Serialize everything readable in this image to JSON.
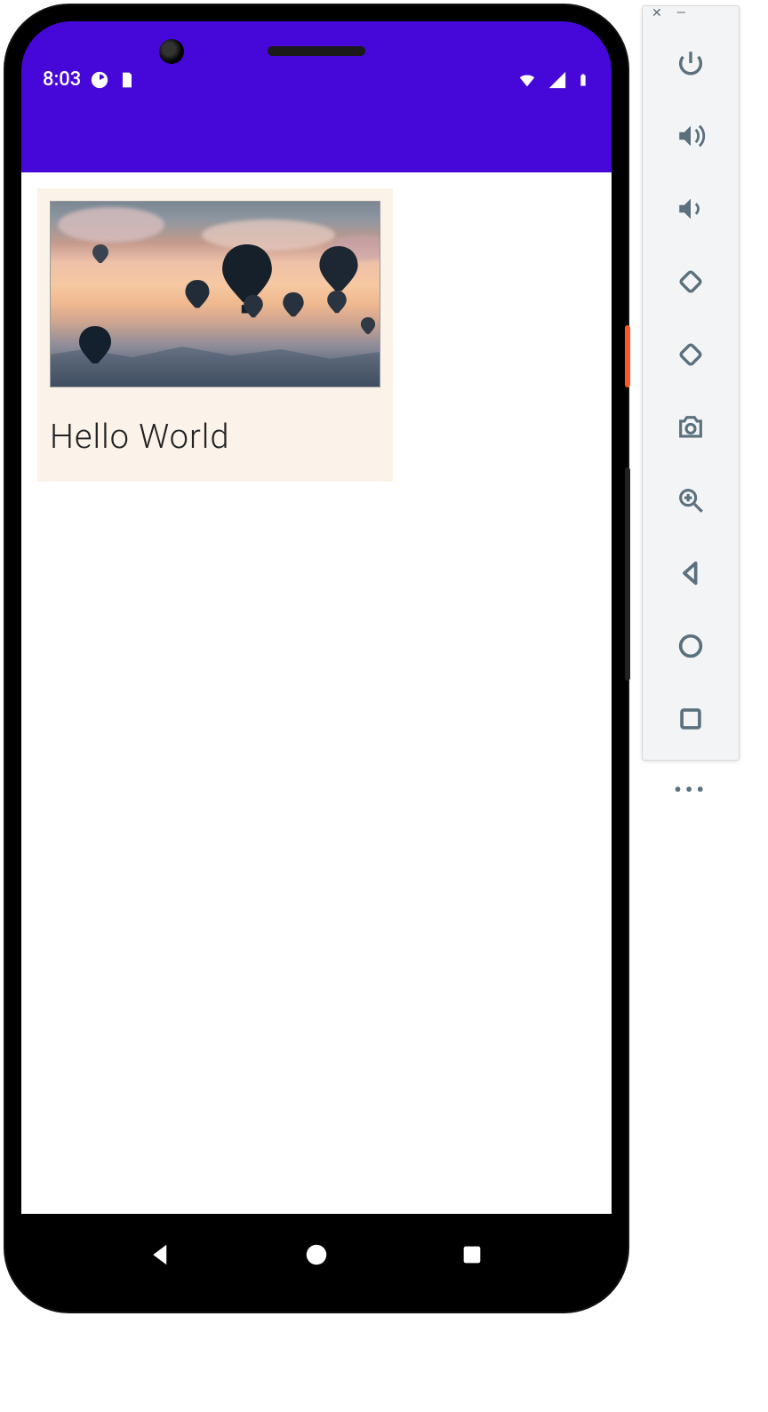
{
  "statusbar": {
    "time": "8:03",
    "icons_left": [
      "timer-icon",
      "sdcard-icon"
    ],
    "icons_right": [
      "wifi-icon",
      "signal-icon",
      "battery-icon"
    ]
  },
  "card": {
    "title": "Hello World",
    "image_alt": "hot air balloons at sunset"
  },
  "navbar": {
    "back": "Back",
    "home": "Home",
    "recent": "Recent apps"
  },
  "emulator_toolbar": {
    "window": {
      "close": "Close",
      "minimize": "Minimize"
    },
    "buttons": [
      {
        "name": "power-icon",
        "label": "Power"
      },
      {
        "name": "volume-up-icon",
        "label": "Volume up"
      },
      {
        "name": "volume-down-icon",
        "label": "Volume down"
      },
      {
        "name": "rotate-left-icon",
        "label": "Rotate left"
      },
      {
        "name": "rotate-right-icon",
        "label": "Rotate right"
      },
      {
        "name": "camera-icon",
        "label": "Take screenshot"
      },
      {
        "name": "zoom-in-icon",
        "label": "Zoom"
      },
      {
        "name": "back-icon",
        "label": "Back"
      },
      {
        "name": "home-icon",
        "label": "Home"
      },
      {
        "name": "overview-icon",
        "label": "Overview"
      }
    ],
    "more": "More"
  }
}
